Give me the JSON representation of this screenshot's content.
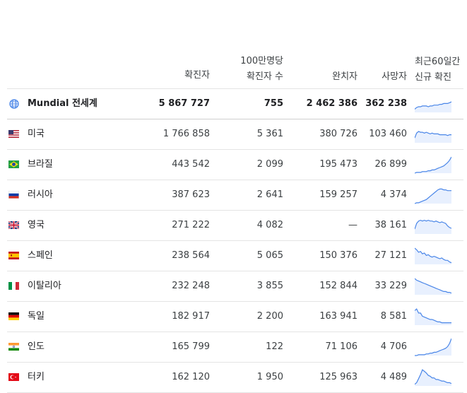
{
  "header": {
    "confirmed": "확진자",
    "per_million_line1": "100만명당",
    "per_million_line2": "확진자 수",
    "recovered": "완치자",
    "deaths": "사망자",
    "trend_line1": "최근60일간",
    "trend_line2": "신규 확진"
  },
  "colors": {
    "line": "#4a86e8",
    "fill": "#e8f0fe",
    "divider": "#e4e4e4"
  },
  "world": {
    "name": "Mundial 전세계",
    "icon": "globe-icon",
    "confirmed": "5 867 727",
    "per_million": "755",
    "recovered": "2 462 386",
    "deaths": "362 238",
    "trend": [
      4,
      6,
      7,
      7,
      8,
      8,
      8,
      7,
      8,
      8,
      9,
      9,
      9,
      10,
      10,
      11,
      11,
      11,
      12,
      13
    ]
  },
  "rows": [
    {
      "name": "미국",
      "flag": "us-flag-icon",
      "confirmed": "1 766 858",
      "per_million": "5 361",
      "recovered": "380 726",
      "deaths": "103 460",
      "trend": [
        6,
        12,
        14,
        13,
        13,
        12,
        13,
        12,
        11,
        12,
        11,
        11,
        11,
        10,
        10,
        10,
        10,
        9,
        10,
        10
      ]
    },
    {
      "name": "브라질",
      "flag": "brazil-flag-icon",
      "confirmed": "443 542",
      "per_million": "2 099",
      "recovered": "195 473",
      "deaths": "26 899",
      "trend": [
        0,
        1,
        1,
        1,
        2,
        2,
        2,
        3,
        3,
        4,
        4,
        5,
        6,
        7,
        8,
        9,
        11,
        13,
        16,
        20
      ]
    },
    {
      "name": "러시아",
      "flag": "russia-flag-icon",
      "confirmed": "387 623",
      "per_million": "2 641",
      "recovered": "159 257",
      "deaths": "4 374",
      "trend": [
        0,
        1,
        1,
        2,
        3,
        4,
        5,
        7,
        9,
        11,
        13,
        15,
        17,
        18,
        18,
        17,
        17,
        16,
        16,
        16
      ]
    },
    {
      "name": "영국",
      "flag": "uk-flag-icon",
      "confirmed": "271 222",
      "per_million": "4 082",
      "recovered": "—",
      "deaths": "38 161",
      "trend": [
        6,
        13,
        16,
        17,
        16,
        17,
        16,
        17,
        16,
        16,
        15,
        16,
        15,
        14,
        15,
        14,
        13,
        10,
        8,
        7
      ]
    },
    {
      "name": "스페인",
      "flag": "spain-flag-icon",
      "confirmed": "238 564",
      "per_million": "5 065",
      "recovered": "150 376",
      "deaths": "27 121",
      "trend": [
        20,
        18,
        15,
        16,
        13,
        14,
        11,
        12,
        10,
        9,
        10,
        9,
        8,
        7,
        8,
        6,
        5,
        5,
        3,
        2
      ]
    },
    {
      "name": "이탈리아",
      "flag": "italy-flag-icon",
      "confirmed": "232 248",
      "per_million": "3 855",
      "recovered": "152 844",
      "deaths": "33 229",
      "trend": [
        20,
        18,
        17,
        16,
        15,
        14,
        13,
        12,
        11,
        10,
        9,
        8,
        7,
        6,
        5,
        4,
        4,
        3,
        3,
        2
      ]
    },
    {
      "name": "독일",
      "flag": "germany-flag-icon",
      "confirmed": "182 917",
      "per_million": "2 200",
      "recovered": "163 941",
      "deaths": "8 581",
      "trend": [
        18,
        20,
        15,
        15,
        11,
        10,
        9,
        8,
        7,
        7,
        6,
        5,
        4,
        4,
        3,
        3,
        3,
        3,
        3,
        3
      ]
    },
    {
      "name": "인도",
      "flag": "india-flag-icon",
      "confirmed": "165 799",
      "per_million": "122",
      "recovered": "71 106",
      "deaths": "4 706",
      "trend": [
        0,
        0,
        1,
        1,
        1,
        1,
        2,
        2,
        3,
        3,
        4,
        4,
        5,
        6,
        7,
        8,
        9,
        11,
        15,
        21
      ]
    },
    {
      "name": "터키",
      "flag": "turkey-flag-icon",
      "confirmed": "162 120",
      "per_million": "1 950",
      "recovered": "125 963",
      "deaths": "4 489",
      "trend": [
        2,
        4,
        9,
        14,
        20,
        18,
        16,
        13,
        12,
        10,
        10,
        8,
        8,
        7,
        6,
        6,
        5,
        4,
        4,
        3
      ]
    }
  ]
}
